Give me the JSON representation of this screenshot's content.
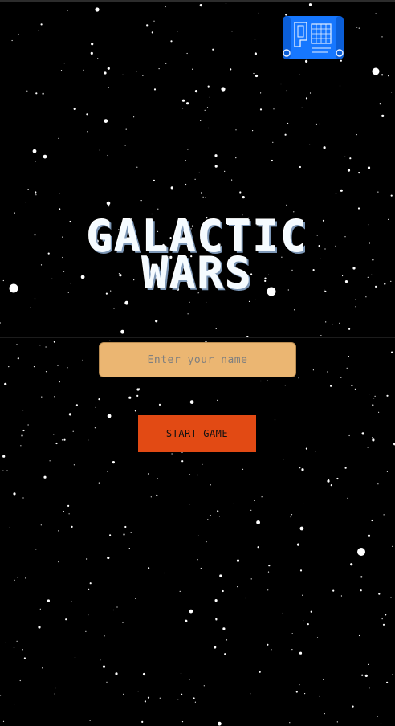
{
  "game": {
    "title_line_1": "GALACTIC",
    "title_line_2": "WARS"
  },
  "name_field": {
    "value": "",
    "placeholder": "Enter your name"
  },
  "start_button": {
    "label": "START GAME"
  },
  "toolbar": {
    "blueprint_icon": "blueprint-scroll-icon"
  },
  "colors": {
    "background": "#000000",
    "star": "#ffffff",
    "title": "#f5fbff",
    "title_shadow": "#7d97b6",
    "input_fill": "#ebb672",
    "button_fill": "#e24a14",
    "blueprint_blue": "#1677ff"
  }
}
